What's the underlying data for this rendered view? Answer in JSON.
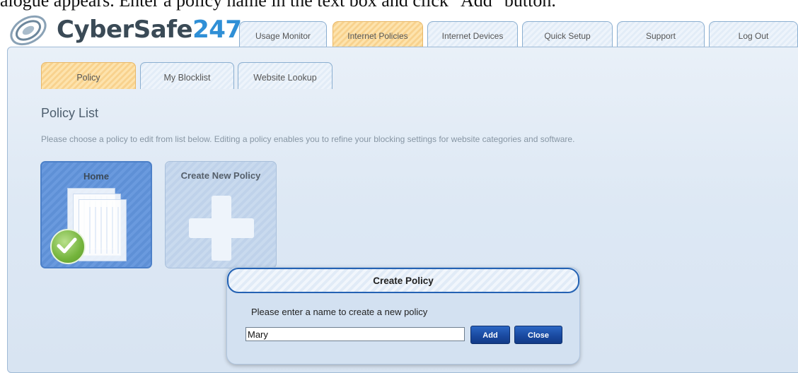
{
  "caption": "alogue appears. Enter a policy name in the text box and click \"Add\" button.",
  "brand": {
    "name_text": "CyberSafe",
    "name_number": "247"
  },
  "top_tabs": [
    {
      "label": "Usage Monitor",
      "active": false
    },
    {
      "label": "Internet Policies",
      "active": true
    },
    {
      "label": "Internet Devices",
      "active": false
    },
    {
      "label": "Quick Setup",
      "active": false
    },
    {
      "label": "Support",
      "active": false
    },
    {
      "label": "Log Out",
      "active": false
    }
  ],
  "sub_tabs": [
    {
      "label": "Policy",
      "active": true
    },
    {
      "label": "My Blocklist",
      "active": false
    },
    {
      "label": "Website Lookup",
      "active": false
    }
  ],
  "main": {
    "title": "Policy List",
    "instructions": "Please choose a policy to edit from list below. Editing a policy enables you to refine your blocking settings for website categories and software."
  },
  "cards": [
    {
      "title": "Home",
      "icon": "documents-check-icon",
      "selected": true
    },
    {
      "title": "Create New Policy",
      "icon": "plus-icon",
      "selected": false
    }
  ],
  "dialog": {
    "title": "Create Policy",
    "prompt": "Please enter a name to create a new policy",
    "input_value": "Mary",
    "add_label": "Add",
    "close_label": "Close"
  },
  "colors": {
    "accent_tab": "#f8d28e",
    "brand_number": "#2f8fd6",
    "button_blue": "#1a4aa1",
    "card_selected": "#5e90d6"
  }
}
